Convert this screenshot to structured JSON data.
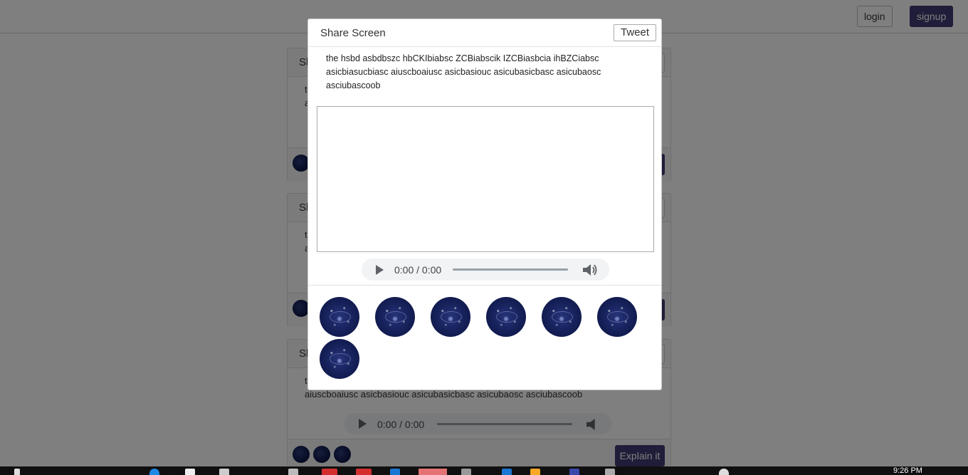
{
  "navbar": {
    "login_label": "login",
    "signup_label": "signup"
  },
  "background_cards": [
    {
      "title": "Sh",
      "line1": "t",
      "line2": "a"
    },
    {
      "title": "Sh",
      "line1": "t",
      "line2": "a"
    },
    {
      "title": "Sh",
      "line1": "t",
      "line2": "aiuscboaiusc asicbasiouc asicubasicbasc asicubaosc asciubascoob",
      "audio_time": "0:00 / 0:00",
      "explain_label": "Explain it"
    }
  ],
  "modal": {
    "title": "Share Screen",
    "tweet_label": "Tweet",
    "text": "the hsbd asbdbszc hbCKIbiabsc ZCBiabscik IZCBiasbcia ihBZCiabsc asicbiasucbiasc aiuscboaiusc asicbasiouc asicubasicbasc asicubaosc asciubascoob",
    "audio": {
      "time": "0:00 / 0:00",
      "progress": 0
    },
    "avatar_count": 7
  },
  "taskbar": {
    "clock": "9:26 PM"
  },
  "colors": {
    "accent": "#3f3b73",
    "overlay": "rgba(0,0,0,0.5)",
    "avatar_bg": "#152058"
  }
}
